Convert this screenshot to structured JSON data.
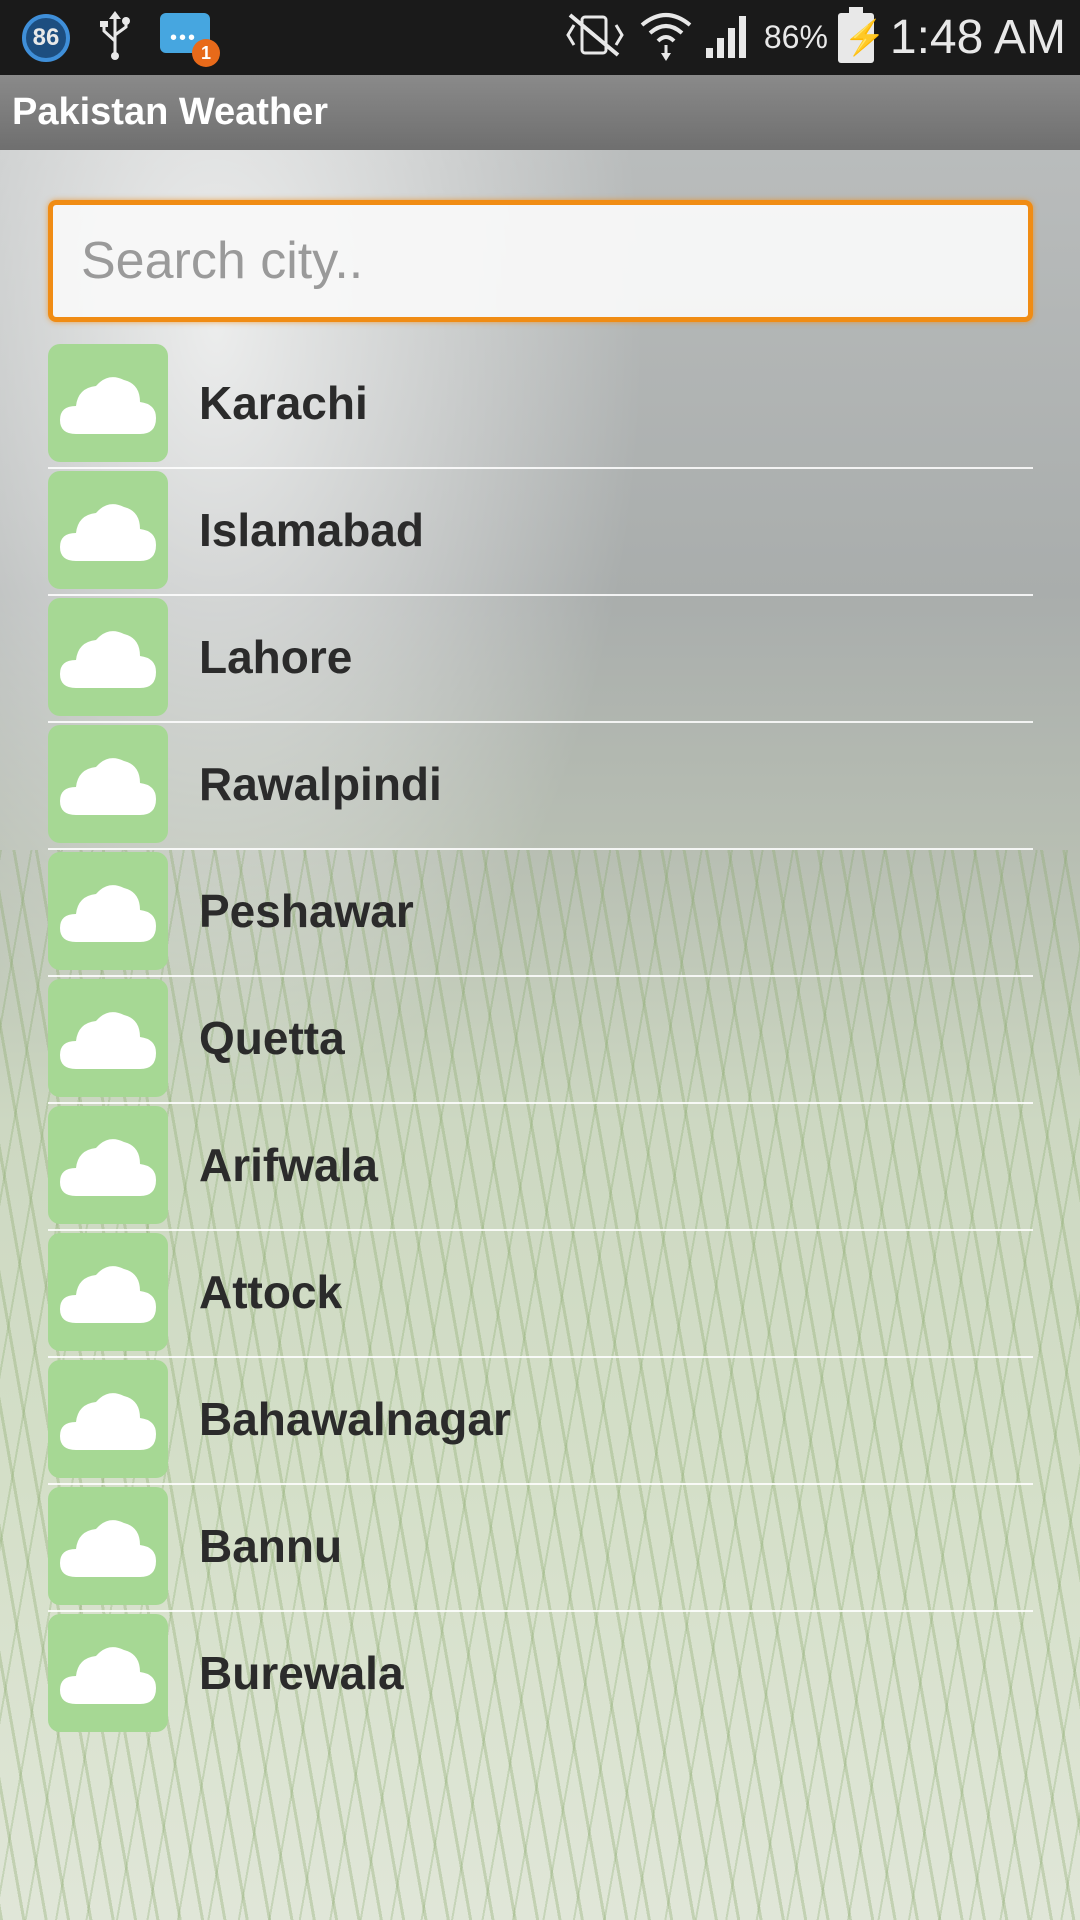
{
  "status_bar": {
    "notification_badge": "86",
    "message_count": "1",
    "battery_percent": "86%",
    "time": "1:48 AM",
    "icons": [
      "usb-icon",
      "message-icon",
      "vibrate-mute-icon",
      "wifi-icon",
      "signal-icon",
      "battery-charging-icon"
    ]
  },
  "app": {
    "title": "Pakistan Weather"
  },
  "search": {
    "placeholder": "Search city.."
  },
  "cities": [
    {
      "name": "Karachi",
      "icon": "cloud-icon"
    },
    {
      "name": "Islamabad",
      "icon": "cloud-icon"
    },
    {
      "name": "Lahore",
      "icon": "cloud-icon"
    },
    {
      "name": "Rawalpindi",
      "icon": "cloud-icon"
    },
    {
      "name": "Peshawar",
      "icon": "cloud-icon"
    },
    {
      "name": "Quetta",
      "icon": "cloud-icon"
    },
    {
      "name": "Arifwala",
      "icon": "cloud-icon"
    },
    {
      "name": "Attock",
      "icon": "cloud-icon"
    },
    {
      "name": "Bahawalnagar",
      "icon": "cloud-icon"
    },
    {
      "name": "Bannu",
      "icon": "cloud-icon"
    },
    {
      "name": "Burewala",
      "icon": "cloud-icon"
    }
  ],
  "colors": {
    "accent": "#f08c14",
    "icon_tile": "#a6d894",
    "action_bar": "#7a7a7a"
  }
}
